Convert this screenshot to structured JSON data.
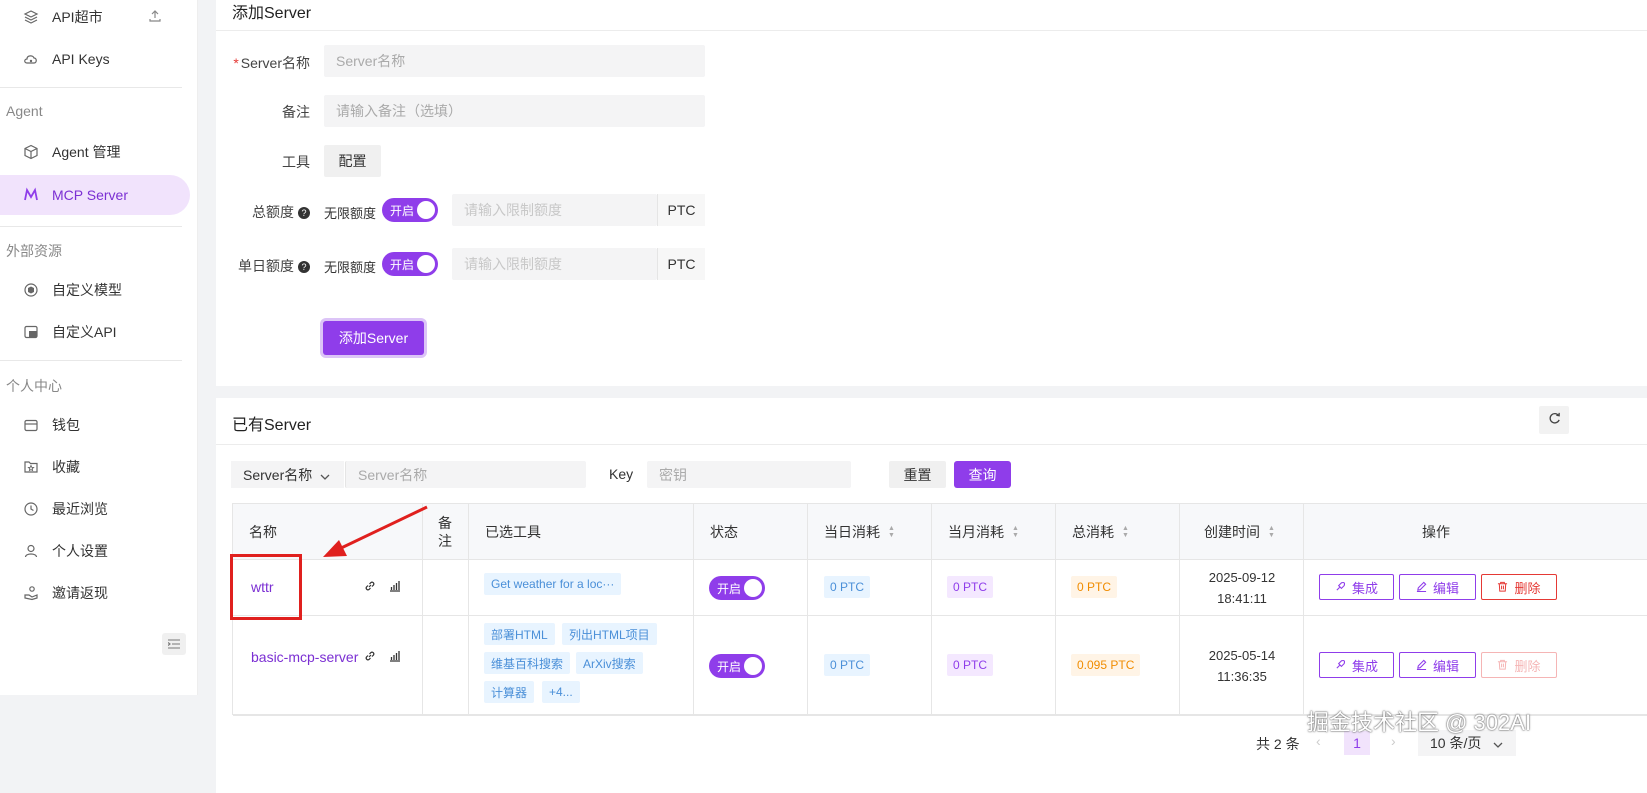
{
  "sidebar": {
    "items_top": [
      {
        "label": "API超市",
        "icon": "layers-icon"
      },
      {
        "label": "API Keys",
        "icon": "cloud-key-icon"
      }
    ],
    "groups": {
      "agent": "Agent",
      "external": "外部资源",
      "personal": "个人中心"
    },
    "agent_items": [
      {
        "label": "Agent 管理",
        "icon": "cube-icon"
      },
      {
        "label": "MCP Server",
        "icon": "mcp-icon",
        "active": true
      }
    ],
    "external_items": [
      {
        "label": "自定义模型",
        "icon": "model-icon"
      },
      {
        "label": "自定义API",
        "icon": "api-icon"
      }
    ],
    "personal_items": [
      {
        "label": "钱包",
        "icon": "wallet-icon"
      },
      {
        "label": "收藏",
        "icon": "star-folder-icon"
      },
      {
        "label": "最近浏览",
        "icon": "history-icon"
      },
      {
        "label": "个人设置",
        "icon": "user-icon"
      },
      {
        "label": "邀请返现",
        "icon": "invite-icon"
      }
    ]
  },
  "add_form": {
    "title": "添加Server",
    "name_label": "Server名称",
    "name_placeholder": "Server名称",
    "remark_label": "备注",
    "remark_placeholder": "请输入备注（选填）",
    "tools_label": "工具",
    "tools_button": "配置",
    "total_quota_label": "总额度",
    "daily_quota_label": "单日额度",
    "unlimited_label": "无限额度",
    "toggle_on": "开启",
    "limit_placeholder": "请输入限制额度",
    "unit": "PTC",
    "submit": "添加Server"
  },
  "server_list": {
    "title": "已有Server",
    "filter_field": "Server名称",
    "filter_placeholder": "Server名称",
    "key_label": "Key",
    "key_placeholder": "密钥",
    "reset": "重置",
    "query": "查询",
    "columns": [
      "名称",
      "备注",
      "已选工具",
      "状态",
      "当日消耗",
      "当月消耗",
      "总消耗",
      "创建时间",
      "操作"
    ],
    "rows": [
      {
        "name": "wttr",
        "remark": "",
        "tools": [
          "Get weather for a loc···"
        ],
        "status": "开启",
        "daily": "0 PTC",
        "monthly": "0 PTC",
        "total": "0 PTC",
        "created_date": "2025-09-12",
        "created_time": "18:41:11",
        "actions": [
          "集成",
          "编辑",
          "删除"
        ]
      },
      {
        "name": "basic-mcp-server",
        "remark": "",
        "tools": [
          "部署HTML",
          "列出HTML项目",
          "维基百科搜索",
          "ArXiv搜索",
          "计算器",
          "+4..."
        ],
        "status": "开启",
        "daily": "0 PTC",
        "monthly": "0 PTC",
        "total": "0.095 PTC",
        "created_date": "2025-05-14",
        "created_time": "11:36:35",
        "actions": [
          "集成",
          "编辑",
          "删除"
        ]
      }
    ],
    "pagination": {
      "total": "共 2 条",
      "current_page": "1",
      "page_size": "10 条/页"
    }
  },
  "watermark": "掘金技术社区 @ 302AI",
  "colors": {
    "primary": "#8f3dea",
    "annotation": "#e0201e"
  }
}
